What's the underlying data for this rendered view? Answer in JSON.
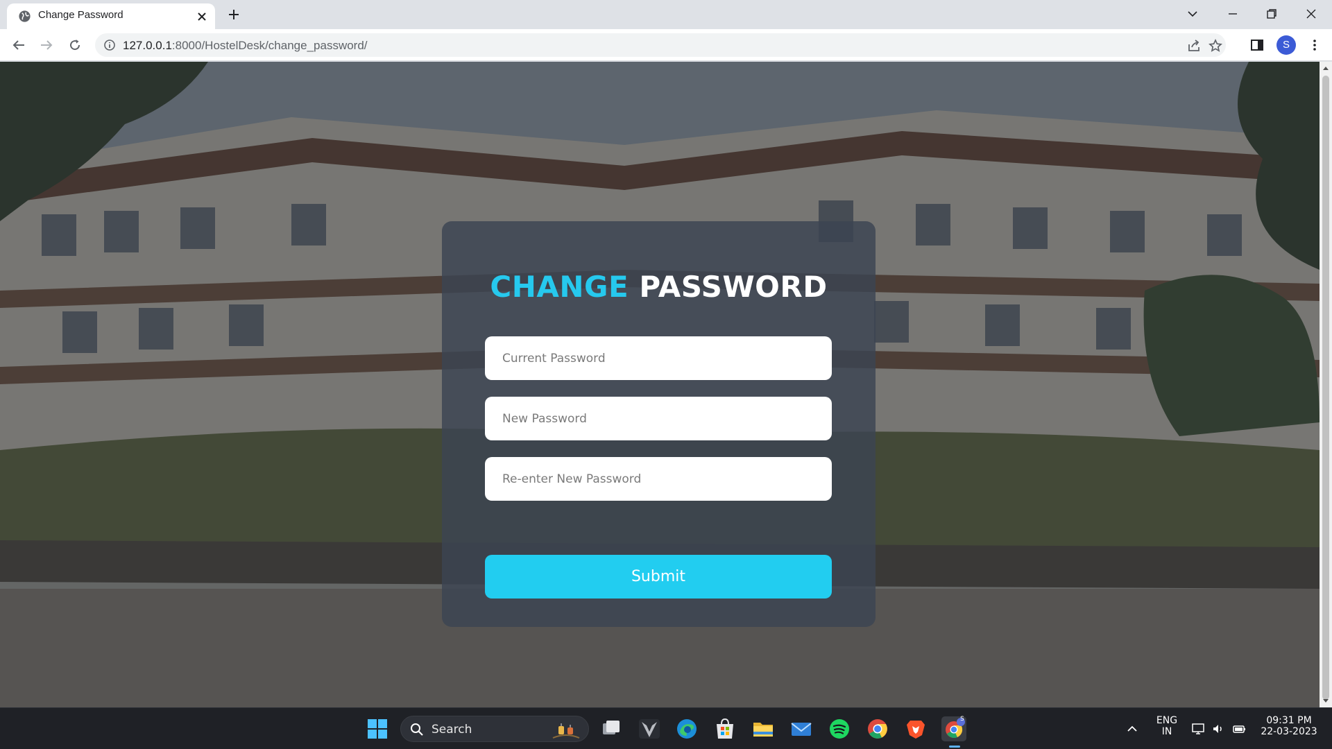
{
  "browser": {
    "tab": {
      "title": "Change Password"
    },
    "address_bar": {
      "host": "127.0.0.1",
      "path": ":8000/HostelDesk/change_password/"
    },
    "profile_initial": "S"
  },
  "page": {
    "title_accent": "CHANGE",
    "title_rest": "PASSWORD",
    "fields": {
      "current_placeholder": "Current Password",
      "new_placeholder": "New Password",
      "confirm_placeholder": "Re-enter New Password"
    },
    "submit_label": "Submit"
  },
  "taskbar": {
    "search_label": "Search",
    "language": {
      "line1": "ENG",
      "line2": "IN"
    },
    "clock": {
      "time": "09:31 PM",
      "date": "22-03-2023"
    },
    "chrome_badge": "S"
  },
  "colors": {
    "accent": "#26c9ee",
    "submit": "#22cdf0",
    "taskbar": "#1f2126"
  }
}
